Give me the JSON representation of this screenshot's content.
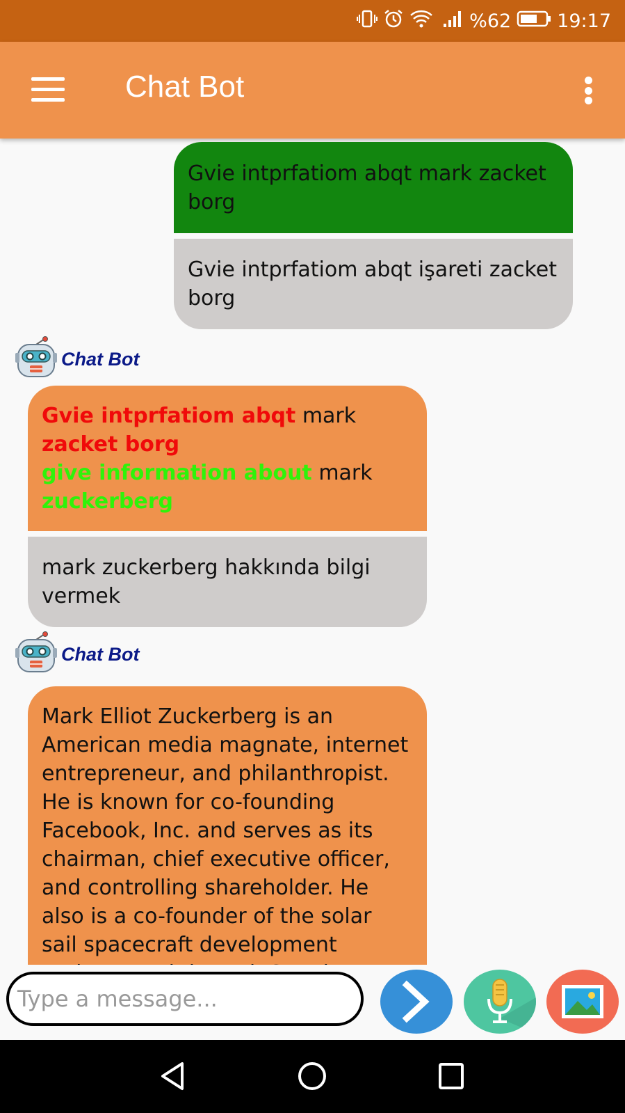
{
  "status_bar": {
    "battery": "%62",
    "time": "19:17"
  },
  "app_bar": {
    "title": "Chat Bot"
  },
  "messages": {
    "user1": {
      "original": "Gvie intprfatiom abqt mark zacket borg",
      "translated": "Gvie intprfatiom abqt işareti zacket borg"
    },
    "bot1": {
      "sender": "Chat Bot",
      "line1_part1": "Gvie intprfatiom abqt",
      "line1_part2": "mark",
      "line1_part3": "zacket borg",
      "line2_part1": "give information about",
      "line2_part2": "mark",
      "line2_part3": "zuckerberg",
      "translated": "mark zuckerberg hakkında bilgi vermek"
    },
    "bot2": {
      "sender": "Chat Bot",
      "text": "Mark Elliot Zuckerberg is an American media magnate, internet entrepreneur, and philanthropist. He is known for co-founding Facebook, Inc. and serves as its chairman, chief executive officer, and controlling shareholder. He also is a co-founder of the solar sail spacecraft development project Breakthrough Starshot"
    }
  },
  "input": {
    "placeholder": "Type a message..."
  },
  "colors": {
    "status_bar": "#c56212",
    "app_bar": "#ef924c",
    "user_bubble": "#12860f",
    "translation_bubble": "#cfcccb",
    "bot_bubble": "#ef924c",
    "bot_name": "#0b1a88",
    "misspelled": "#f00a0a",
    "corrected": "#2ef30a"
  },
  "icons": [
    "vibrate-icon",
    "alarm-icon",
    "wifi-icon",
    "signal-icon",
    "battery-icon",
    "menu-icon",
    "overflow-menu-icon",
    "robot-avatar-icon",
    "send-icon",
    "microphone-icon",
    "image-icon",
    "nav-back-icon",
    "nav-home-icon",
    "nav-recents-icon"
  ]
}
